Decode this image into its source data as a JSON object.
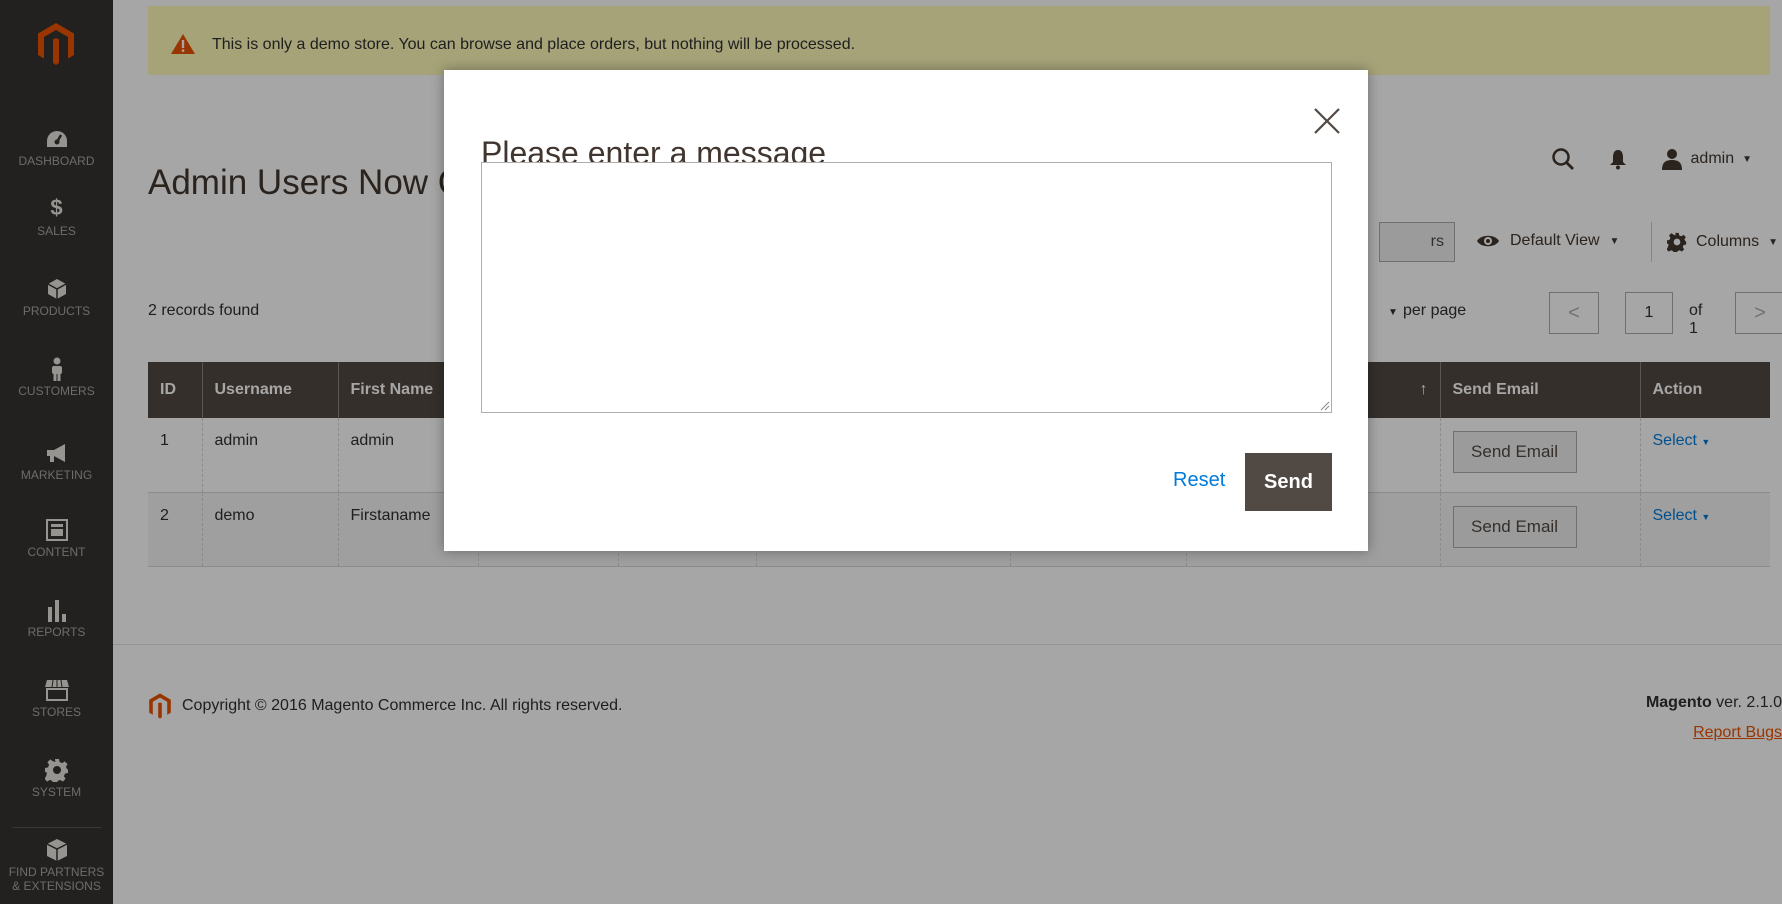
{
  "sidebar": {
    "items": [
      {
        "label": "DASHBOARD",
        "icon": "dashboard-icon"
      },
      {
        "label": "SALES",
        "icon": "dollar-icon"
      },
      {
        "label": "PRODUCTS",
        "icon": "cube-icon"
      },
      {
        "label": "CUSTOMERS",
        "icon": "person-icon"
      },
      {
        "label": "MARKETING",
        "icon": "megaphone-icon"
      },
      {
        "label": "CONTENT",
        "icon": "layout-icon"
      },
      {
        "label": "REPORTS",
        "icon": "bar-chart-icon"
      },
      {
        "label": "STORES",
        "icon": "storefront-icon"
      },
      {
        "label": "SYSTEM",
        "icon": "gear-icon"
      },
      {
        "label": "FIND PARTNERS",
        "label2": "& EXTENSIONS",
        "icon": "partners-cube-icon"
      }
    ]
  },
  "notice": {
    "text": "This is only a demo store. You can browse and place orders, but nothing will be processed."
  },
  "header": {
    "title": "Admin Users Now C",
    "user": "admin"
  },
  "toolbar": {
    "filters_partial": "rs",
    "default_view": "Default View",
    "columns": "Columns"
  },
  "records": "2 records found",
  "pager": {
    "per_page": "per page",
    "page": "1",
    "of": "of 1",
    "prev": "<",
    "next": ">"
  },
  "table": {
    "headers": [
      "ID",
      "Username",
      "First Name",
      "",
      "",
      "",
      "",
      "",
      "↑",
      "Send Email",
      "Action"
    ],
    "rows": [
      {
        "id": "1",
        "username": "admin",
        "first_name": "admin",
        "send_email": "Send Email",
        "action": "Select"
      },
      {
        "id": "2",
        "username": "demo",
        "first_name": "Firstaname",
        "send_email": "Send Email",
        "action": "Select"
      }
    ]
  },
  "footer": {
    "copyright": "Copyright © 2016 Magento Commerce Inc. All rights reserved.",
    "brand": "Magento",
    "version": " ver. 2.1.0",
    "report_bugs": "Report Bugs"
  },
  "modal": {
    "title": "Please enter a message",
    "message_value": "",
    "reset_label": "Reset",
    "send_label": "Send"
  },
  "colors": {
    "accent": "#eb5202",
    "link": "#007bdb",
    "dark": "#514943",
    "notice_bg": "#fffbbb"
  }
}
